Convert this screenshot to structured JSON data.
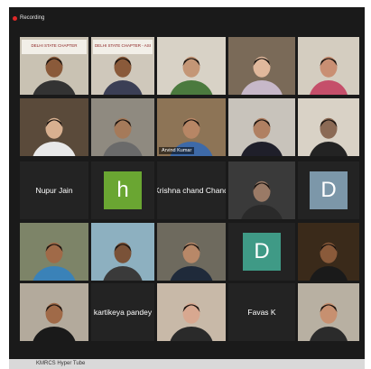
{
  "recording": {
    "label": "Recording"
  },
  "participants": [
    {
      "name": "",
      "type": "video",
      "bg": "#c9c2b3",
      "skin": "#8a5a3a",
      "shirt": "#333333",
      "banner": "DELHI STATE CHAPTER"
    },
    {
      "name": "",
      "type": "video",
      "bg": "#cfc8bb",
      "skin": "#8a5a3a",
      "shirt": "#3b3f55",
      "banner": "DELHI STATE CHAPTER - ASI"
    },
    {
      "name": "",
      "type": "video",
      "bg": "#d8d2c6",
      "skin": "#c49676",
      "shirt": "#4b7a3e"
    },
    {
      "name": "",
      "type": "video",
      "bg": "#7a6a58",
      "skin": "#e0b89c",
      "shirt": "#c7b8c9"
    },
    {
      "name": "",
      "type": "video",
      "bg": "#d4cdc0",
      "skin": "#c98f73",
      "shirt": "#c54f6a"
    },
    {
      "name": "",
      "type": "video",
      "bg": "#5a4a3a",
      "skin": "#d8b090",
      "shirt": "#e8e8e8"
    },
    {
      "name": "",
      "type": "video",
      "bg": "#8f8a80",
      "skin": "#a57a5a",
      "shirt": "#6a6a6a"
    },
    {
      "name": "Arvind Kumar",
      "type": "video",
      "bg": "#8d7456",
      "skin": "#b78665",
      "shirt": "#3e6aa8",
      "active": true
    },
    {
      "name": "",
      "type": "video",
      "bg": "#c8c3bb",
      "skin": "#b08062",
      "shirt": "#1f1f2a"
    },
    {
      "name": "",
      "type": "video",
      "bg": "#d9d2c6",
      "skin": "#8b6a55",
      "shirt": "#232323"
    },
    {
      "name": "Nupur Jain",
      "type": "name"
    },
    {
      "name": "",
      "type": "avatar",
      "letter": "h",
      "color": "#6aa632"
    },
    {
      "name": "Krishna chand Chand",
      "type": "name"
    },
    {
      "name": "",
      "type": "video",
      "bg": "#3a3a3a",
      "skin": "#9a7a66",
      "shirt": "#2a2a2a",
      "mono": true
    },
    {
      "name": "",
      "type": "avatar",
      "letter": "D",
      "color": "#7c97a9"
    },
    {
      "name": "",
      "type": "video",
      "bg": "#7d8468",
      "skin": "#a06a48",
      "shirt": "#3a82b8"
    },
    {
      "name": "",
      "type": "video",
      "bg": "#8db0c0",
      "skin": "#7a5238",
      "shirt": "#3a3a3a"
    },
    {
      "name": "",
      "type": "video",
      "bg": "#6e6a5e",
      "skin": "#b88868",
      "shirt": "#1f2a3a"
    },
    {
      "name": "",
      "type": "avatar",
      "letter": "D",
      "color": "#3f9a86"
    },
    {
      "name": "",
      "type": "video",
      "bg": "#3a2a1a",
      "skin": "#8a5a3a",
      "shirt": "#1a1a1a"
    },
    {
      "name": "",
      "type": "video",
      "bg": "#b3aa9c",
      "skin": "#a06a48",
      "shirt": "#1a1a1a"
    },
    {
      "name": "kartikeya pandey",
      "type": "name"
    },
    {
      "name": "",
      "type": "video",
      "bg": "#c8b9a8",
      "skin": "#d8a890",
      "shirt": "#2a2a2a"
    },
    {
      "name": "Favas K",
      "type": "name"
    },
    {
      "name": "",
      "type": "video",
      "bg": "#b8b0a2",
      "skin": "#c79070",
      "shirt": "#2b2b2b"
    }
  ],
  "bottom": {
    "label": "KMRCS Hyper Tube"
  }
}
